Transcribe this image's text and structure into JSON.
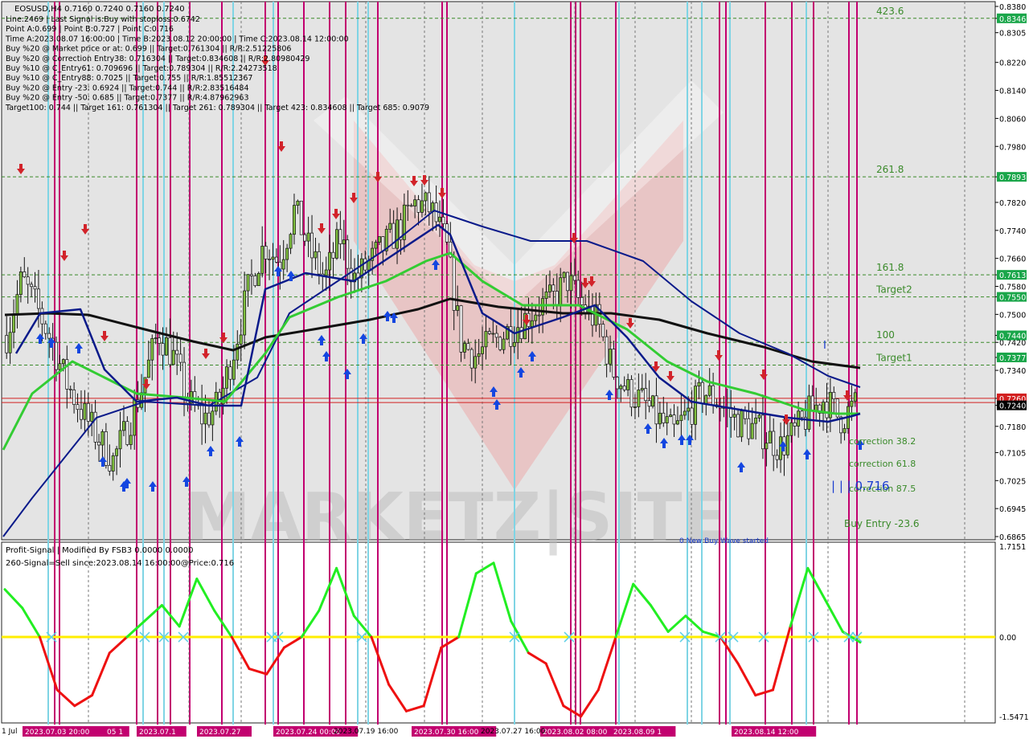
{
  "main_panel": {
    "title_line": "EOSUSD,H4  0.7160 0.7240 0.7160 0.7240",
    "info_lines": [
      "Line:2469 | Last Signal is:Buy with stoploss:0.6742",
      "Point A:0.699 | Point B:0.727 | Point C:0.716",
      "Time A:2023.08.07 16:00:00 | Time B:2023.08.12 20:00:00 | Time C:2023.08.14 12:00:00",
      "Buy %20 @ Market price or at: 0.699 || Target:0.761304 || R/R:2.51225806",
      "Buy %20 @ Correction Entry38: 0.716304 || Target:0.834608 || R/R:2.80980429",
      "Buy %10 @ C_Entry61: 0.709696 || Target:0.789304 || R/R:2.24273518",
      "Buy %10 @ C_Entry88: 0.7025 || Target:0.755 || R/R:1.85512367",
      "Buy %20 @ Entry -23: 0.6924 || Target:0.744 || R/R:2.83516484",
      "Buy %20 @ Entry -50: 0.685 || Target:0.7377 || R/R:4.87962963",
      "Target100: 0.744 || Target 161: 0.761304 || Target 261: 0.789304 || Target 423: 0.834608 || Target 685: 0.9079"
    ],
    "price_axis_labels": [
      "0.8380",
      "0.8346",
      "0.8305",
      "0.8220",
      "0.8140",
      "0.8060",
      "0.7980",
      "0.7893",
      "0.7820",
      "0.7740",
      "0.7660",
      "0.7613",
      "0.7580",
      "0.7550",
      "0.7500",
      "0.7440",
      "0.7420",
      "0.7377",
      "0.7340",
      "0.7260",
      "0.7240",
      "0.7180",
      "0.7105",
      "0.7025",
      "0.6945",
      "0.6865"
    ],
    "highlighted_prices": [
      {
        "price": 0.8346,
        "color": "#1aa64a"
      },
      {
        "price": 0.7893,
        "color": "#1aa64a"
      },
      {
        "price": 0.7613,
        "color": "#1aa64a"
      },
      {
        "price": 0.755,
        "color": "#1aa64a"
      },
      {
        "price": 0.744,
        "color": "#1aa64a"
      },
      {
        "price": 0.7377,
        "color": "#1aa64a"
      },
      {
        "price": 0.726,
        "color": "#d22020"
      },
      {
        "price": 0.724,
        "color": "#000000"
      }
    ],
    "levels": [
      {
        "label": "423.6",
        "price": 0.8346
      },
      {
        "label": "261.8",
        "price": 0.7893
      },
      {
        "label": "161.8",
        "price": 0.7613
      },
      {
        "label": "Target2",
        "price": 0.755
      },
      {
        "label": "100",
        "price": 0.742
      },
      {
        "label": "Target1",
        "price": 0.7355
      }
    ],
    "correction_labels": [
      "correction 38.2",
      "correction 61.8",
      "correction 87.5",
      "Buy Entry -23.6"
    ],
    "point_label": "| | | 0.716",
    "watermark": "MARKETZ|SITE",
    "bottom_note": "0 New Buy Wave started"
  },
  "indicator_panel": {
    "title": "Profit-Signal | Modified By FSB3 0.0000 0.0000",
    "subtitle": "260-Signal=Sell since:2023.08.14 16:00:00@Price:0.716",
    "axis_labels": [
      "1.7151",
      "0.00",
      "-1.5471"
    ]
  },
  "time_axis": {
    "first_label": "1 Jul",
    "highlighted_labels": [
      "2023.07.03 20:00",
      "05 1",
      "2023.07.1",
      "2023.07.27",
      "2023.07.24 00:00",
      "2023.07.30 16:00",
      "2023.08.02 08:00",
      "2023.08.09 1",
      "2023.08.14 12:00"
    ],
    "plain_labels": [
      "2023.07.19 16:00",
      "2023.07.27 16:00"
    ]
  },
  "colors": {
    "bear": "#d2232a",
    "bull": "#1446e0",
    "magenta": "#c2006f",
    "cyan": "#7fd4e4",
    "ma_green": "#33cc33",
    "ma_navy": "#0a1a8a",
    "ma_black": "#111111",
    "level_green": "#3a8a2a",
    "osc_green": "#22ee22",
    "osc_red": "#ee1111",
    "zero_line": "#ffee00"
  },
  "chart_data": {
    "type": "candlestick",
    "symbol": "EOSUSD",
    "timeframe": "H4",
    "ylim": [
      0.6865,
      0.838
    ],
    "last_price": 0.724,
    "close_approx": [
      0.744,
      0.76,
      0.752,
      0.742,
      0.73,
      0.722,
      0.715,
      0.708,
      0.718,
      0.73,
      0.745,
      0.738,
      0.725,
      0.72,
      0.724,
      0.74,
      0.758,
      0.77,
      0.765,
      0.78,
      0.768,
      0.76,
      0.772,
      0.76,
      0.765,
      0.77,
      0.775,
      0.782,
      0.78,
      0.77,
      0.742,
      0.738,
      0.742,
      0.745,
      0.748,
      0.752,
      0.754,
      0.76,
      0.752,
      0.748,
      0.734,
      0.728,
      0.725,
      0.72,
      0.716,
      0.722,
      0.728,
      0.725,
      0.72,
      0.718,
      0.716,
      0.712,
      0.716,
      0.722,
      0.726,
      0.72,
      0.724
    ],
    "oscillator": {
      "ylim": [
        -1.5471,
        1.7151
      ],
      "values": [
        0.9,
        0.55,
        0.0,
        -1.0,
        -1.3,
        -1.1,
        -0.3,
        0.0,
        0.3,
        0.6,
        0.2,
        1.1,
        0.5,
        0.0,
        -0.6,
        -0.7,
        -0.2,
        0.0,
        0.5,
        1.3,
        0.4,
        0.0,
        -0.9,
        -1.4,
        -1.3,
        -0.2,
        0.0,
        1.2,
        1.4,
        0.3,
        -0.3,
        -0.5,
        -1.3,
        -1.5,
        -1.0,
        0.0,
        1.0,
        0.6,
        0.1,
        0.4,
        0.1,
        0.0,
        -0.5,
        -1.1,
        -1.0,
        0.2,
        1.3,
        0.7,
        0.1,
        -0.1
      ]
    }
  }
}
